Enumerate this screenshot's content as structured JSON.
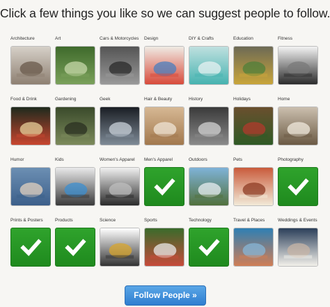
{
  "heading": "Click a few things you like so we can suggest people to follow.",
  "categories": [
    {
      "label": "Architecture",
      "selected": false,
      "icon": "architecture-photo",
      "colors": [
        "#d6d0c8",
        "#8e8072",
        "#6a5a4b"
      ]
    },
    {
      "label": "Art",
      "selected": false,
      "icon": "art-photo",
      "colors": [
        "#3f6a2c",
        "#7aa05a",
        "#c6d7a8"
      ]
    },
    {
      "label": "Cars & Motorcycles",
      "selected": false,
      "icon": "car-photo",
      "colors": [
        "#555",
        "#999",
        "#2a2a2a"
      ]
    },
    {
      "label": "Design",
      "selected": false,
      "icon": "design-photo",
      "colors": [
        "#efeae3",
        "#d84a3a",
        "#4a7fbf"
      ]
    },
    {
      "label": "DIY & Crafts",
      "selected": false,
      "icon": "diy-photo",
      "colors": [
        "#bfe0df",
        "#46b3b0",
        "#e8f2f2"
      ]
    },
    {
      "label": "Education",
      "selected": false,
      "icon": "education-photo",
      "colors": [
        "#6d6a55",
        "#c9a53a",
        "#4f7f3a"
      ]
    },
    {
      "label": "Fitness",
      "selected": false,
      "icon": "fitness-photo",
      "colors": [
        "#f3f3f3",
        "#2b2b2b",
        "#7a7a7a"
      ]
    },
    {
      "label": "Food & Drink",
      "selected": false,
      "icon": "food-photo",
      "colors": [
        "#1e2a1d",
        "#c8452f",
        "#e6cf9a"
      ]
    },
    {
      "label": "Gardening",
      "selected": false,
      "icon": "gardening-photo",
      "colors": [
        "#3a4a2b",
        "#7c8a5b",
        "#2a2f20"
      ]
    },
    {
      "label": "Geek",
      "selected": false,
      "icon": "geek-photo",
      "colors": [
        "#1a1e24",
        "#7e8a96",
        "#c8d0d8"
      ]
    },
    {
      "label": "Hair & Beauty",
      "selected": false,
      "icon": "hair-photo",
      "colors": [
        "#d6b894",
        "#a2784d",
        "#efe4d6"
      ]
    },
    {
      "label": "History",
      "selected": false,
      "icon": "history-photo",
      "colors": [
        "#3a3a3a",
        "#8a8a8a",
        "#d2d2d2"
      ]
    },
    {
      "label": "Holidays",
      "selected": false,
      "icon": "holidays-photo",
      "colors": [
        "#6a4f2e",
        "#2f5a25",
        "#b23a2c"
      ]
    },
    {
      "label": "Home",
      "selected": false,
      "icon": "home-photo",
      "colors": [
        "#cbbfae",
        "#6b5a44",
        "#f0e9dd"
      ]
    },
    {
      "label": "Humor",
      "selected": false,
      "icon": "humor-photo",
      "colors": [
        "#6c8fb3",
        "#3c5f8a",
        "#e3d2bf"
      ]
    },
    {
      "label": "Kids",
      "selected": false,
      "icon": "kids-photo",
      "colors": [
        "#e9e9ea",
        "#3a3a3a",
        "#3c8fd0"
      ]
    },
    {
      "label": "Women's Apparel",
      "selected": false,
      "icon": "womens-apparel-photo",
      "colors": [
        "#f0f0f0",
        "#2a2a2a",
        "#bdbdbd"
      ]
    },
    {
      "label": "Men's Apparel",
      "selected": true,
      "icon": "check-icon",
      "colors": [
        "#2fa32c",
        "#1f8a1e",
        "#ffffff"
      ]
    },
    {
      "label": "Outdoors",
      "selected": false,
      "icon": "outdoors-photo",
      "colors": [
        "#7fb3d8",
        "#51703c",
        "#e8eef2"
      ]
    },
    {
      "label": "Pets",
      "selected": false,
      "icon": "pets-photo",
      "colors": [
        "#c95b3b",
        "#f2ead8",
        "#8e3b23"
      ]
    },
    {
      "label": "Photography",
      "selected": true,
      "icon": "check-icon",
      "colors": [
        "#2fa32c",
        "#1f8a1e",
        "#ffffff"
      ]
    },
    {
      "label": "Prints & Posters",
      "selected": true,
      "icon": "check-icon",
      "colors": [
        "#2fa32c",
        "#1f8a1e",
        "#ffffff"
      ]
    },
    {
      "label": "Products",
      "selected": true,
      "icon": "check-icon",
      "colors": [
        "#2fa32c",
        "#1f8a1e",
        "#ffffff"
      ]
    },
    {
      "label": "Science",
      "selected": false,
      "icon": "science-photo",
      "colors": [
        "#ffffff",
        "#333333",
        "#d8a62d"
      ]
    },
    {
      "label": "Sports",
      "selected": false,
      "icon": "sports-photo",
      "colors": [
        "#3a6b2b",
        "#c64b3a",
        "#e8e8e8"
      ]
    },
    {
      "label": "Technology",
      "selected": true,
      "icon": "check-icon",
      "colors": [
        "#2fa32c",
        "#1f8a1e",
        "#ffffff"
      ]
    },
    {
      "label": "Travel & Places",
      "selected": false,
      "icon": "travel-photo",
      "colors": [
        "#2f7fb4",
        "#d07e55",
        "#86b7d8"
      ]
    },
    {
      "label": "Weddings & Events",
      "selected": false,
      "icon": "weddings-photo",
      "colors": [
        "#2b3f5a",
        "#f2f0ea",
        "#c7b4a6"
      ]
    }
  ],
  "follow_button": "Follow People »"
}
